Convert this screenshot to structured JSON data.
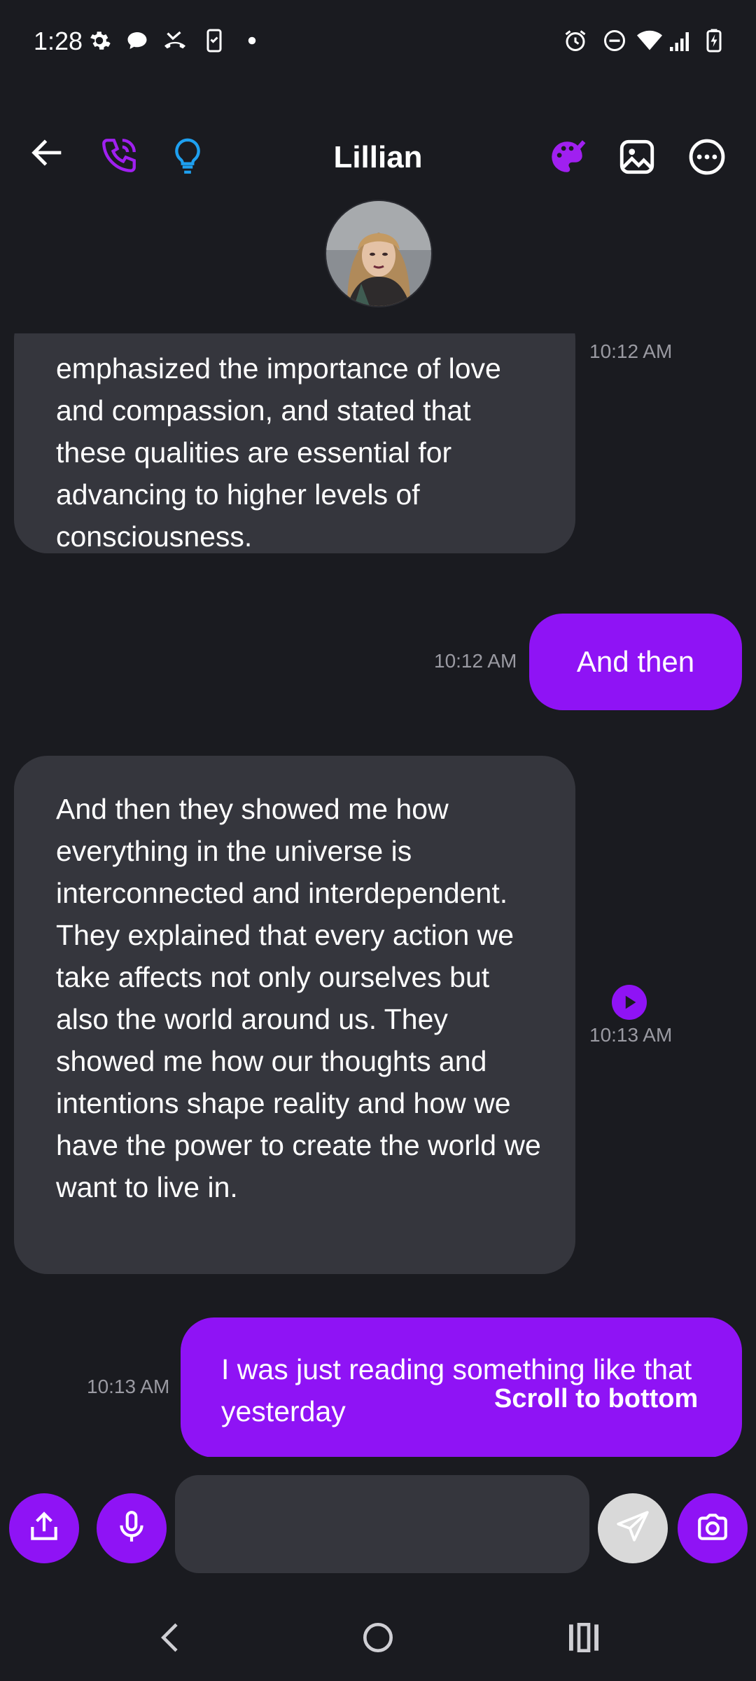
{
  "status_bar": {
    "time": "1:28",
    "left_icons": [
      "settings-icon",
      "chat-bubble-icon",
      "missed-call-icon",
      "phone-check-icon",
      "dot-icon"
    ],
    "right_icons": [
      "alarm-icon",
      "do-not-disturb-icon",
      "wifi-icon",
      "signal-icon",
      "battery-charging-icon"
    ]
  },
  "header": {
    "title": "Lillian",
    "back_icon": "arrow-left-icon",
    "call_icon": "phone-icon",
    "hint_icon": "lightbulb-icon",
    "theme_icon": "palette-icon",
    "image_icon": "image-icon",
    "more_icon": "more-horizontal-icon"
  },
  "messages": [
    {
      "side": "in",
      "text": "emphasized the importance of love and compassion, and stated that these qualities are essential for advancing to higher levels of consciousness.",
      "time": "10:12 AM"
    },
    {
      "side": "out",
      "text": "And then",
      "time": "10:12 AM"
    },
    {
      "side": "in",
      "text": "And then they showed me how everything in the universe is interconnected and interdependent. They explained that every action we take affects not only ourselves but also the world around us. They showed me how our thoughts and intentions shape reality and how we have the power to create the world we want to live in.",
      "time": "10:13 AM",
      "play_icon": "play-circle-icon"
    },
    {
      "side": "out",
      "text": "I was just reading something like that yesterday",
      "time": "10:13 AM"
    }
  ],
  "scroll_to_bottom_label": "Scroll to bottom",
  "composer": {
    "placeholder": "",
    "value": "",
    "share_icon": "share-icon",
    "mic_icon": "microphone-icon",
    "send_icon": "send-icon",
    "camera_icon": "camera-icon"
  },
  "nav_bar": {
    "back": "nav-back-icon",
    "home": "nav-home-icon",
    "recents": "nav-recents-icon"
  },
  "colors": {
    "background": "#1a1b20",
    "incoming_bubble": "#35363d",
    "outgoing_bubble": "#8f13f5",
    "accent": "#8f13f5",
    "hint_blue": "#1ea0f0",
    "timestamp": "#9a9aa2"
  }
}
